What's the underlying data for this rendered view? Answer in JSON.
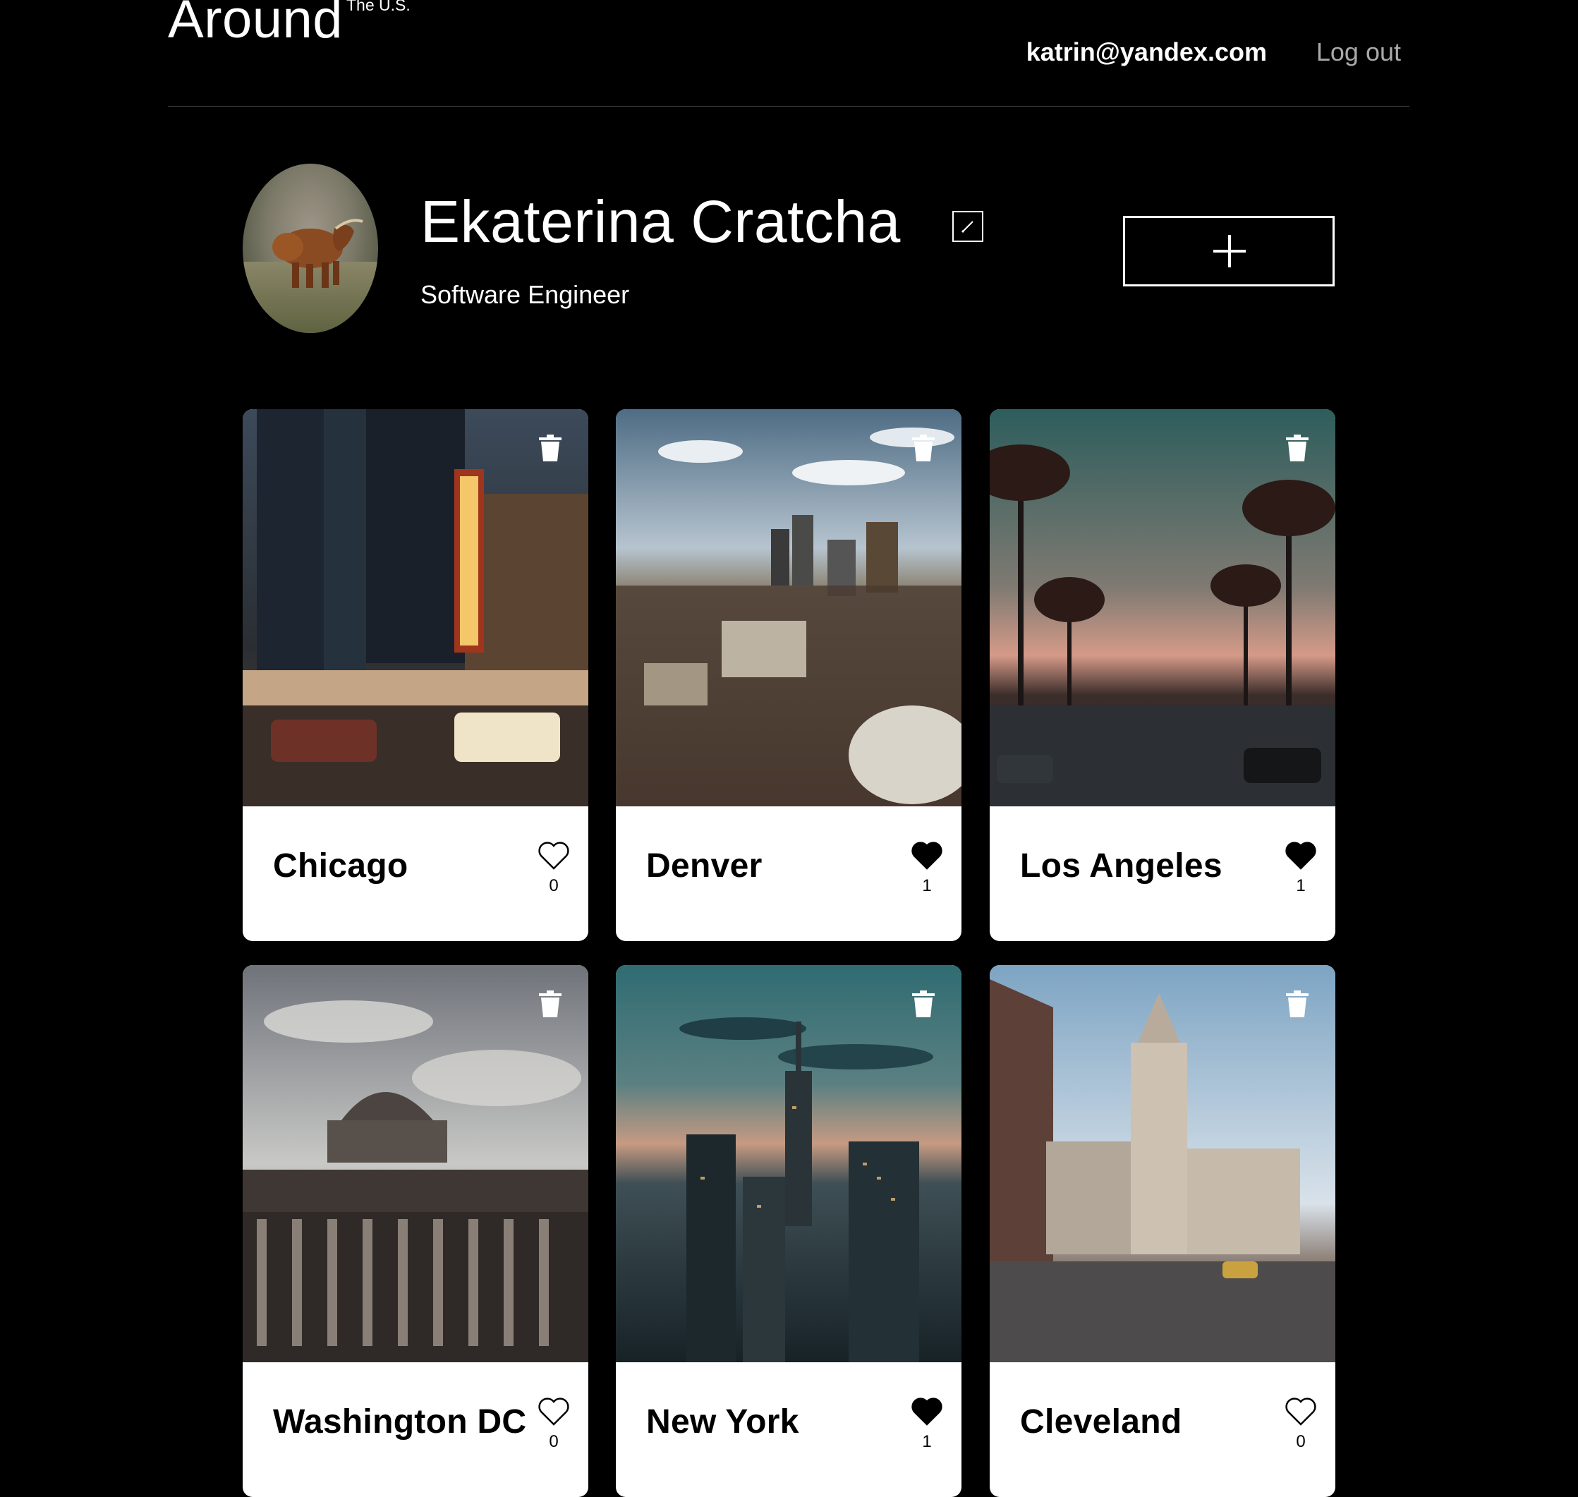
{
  "header": {
    "logo": "Around",
    "logo_sup": "The U.S.",
    "email": "katrin@yandex.com",
    "logout": "Log out"
  },
  "profile": {
    "name": "Ekaterina Cratcha",
    "job": "Software Engineer",
    "avatar_icon": "avatar-highland-cow"
  },
  "icons": {
    "edit": "pencil-icon",
    "add": "plus-icon",
    "delete": "trash-icon",
    "like": "heart-icon"
  },
  "cards": [
    {
      "title": "Chicago",
      "likes": "0",
      "liked": false
    },
    {
      "title": "Denver",
      "likes": "1",
      "liked": true
    },
    {
      "title": "Los Angeles",
      "likes": "1",
      "liked": true
    },
    {
      "title": "Washington DC",
      "likes": "0",
      "liked": false
    },
    {
      "title": "New York",
      "likes": "1",
      "liked": true
    },
    {
      "title": "Cleveland",
      "likes": "0",
      "liked": false
    }
  ]
}
